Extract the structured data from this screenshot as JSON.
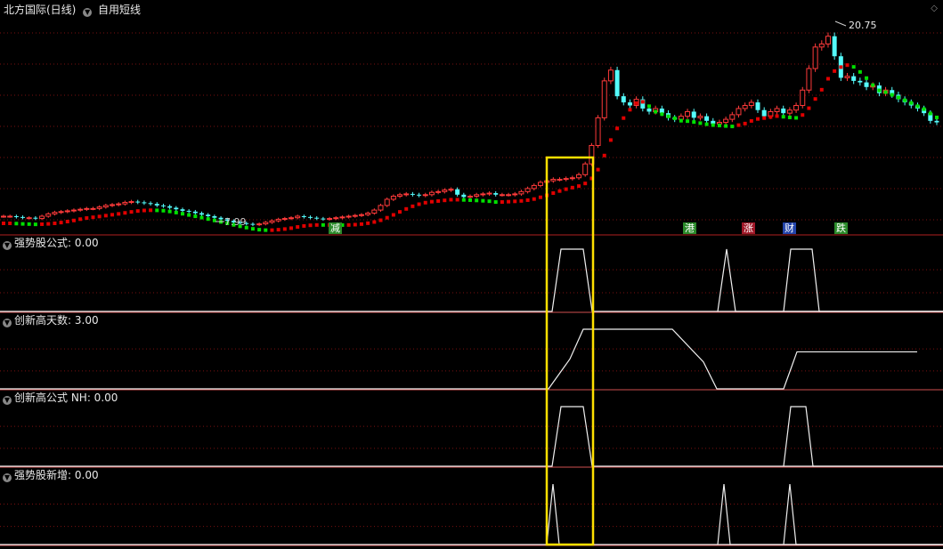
{
  "main": {
    "title": "北方国际(日线)",
    "formula": "自用短线",
    "high_label": "20.75",
    "low_label": "7.99"
  },
  "events": [
    {
      "label": "减",
      "color": "#2a8a2a"
    },
    {
      "label": "港",
      "color": "#2a8a2a"
    },
    {
      "label": "涨",
      "color": "#a01828"
    },
    {
      "label": "财",
      "color": "#2244aa"
    },
    {
      "label": "跌",
      "color": "#2a8a2a"
    }
  ],
  "panels": [
    {
      "label": "强势股公式",
      "value": ": 0.00"
    },
    {
      "label": "创新高天数",
      "value": ": 3.00"
    },
    {
      "label": "创新高公式  NH",
      "value": ": 0.00"
    },
    {
      "label": "强势股新增",
      "value": ": 0.00"
    }
  ],
  "colors": {
    "up": "#ff3a3a",
    "down": "#54fcfc",
    "trend_up": "#e00000",
    "trend_down": "#00e000",
    "grid": "#7a1010",
    "highlight": "#ffe000"
  },
  "chart_data": [
    {
      "type": "candlestick",
      "title": "北方国际(日线)",
      "ylim": [
        7.5,
        21.5
      ],
      "annotations": {
        "high": 20.75,
        "low": 7.99
      },
      "note": "approximate daily closes read from the chart",
      "closes": [
        8.6,
        8.6,
        8.55,
        8.5,
        8.5,
        8.45,
        8.6,
        8.75,
        8.85,
        8.9,
        8.95,
        9.0,
        9.05,
        9.1,
        9.1,
        9.2,
        9.3,
        9.35,
        9.4,
        9.5,
        9.55,
        9.5,
        9.45,
        9.4,
        9.3,
        9.25,
        9.15,
        9.05,
        8.95,
        8.9,
        8.8,
        8.7,
        8.6,
        8.5,
        8.4,
        8.3,
        8.2,
        8.15,
        8.1,
        8.05,
        8.1,
        8.2,
        8.3,
        8.4,
        8.45,
        8.5,
        8.6,
        8.55,
        8.5,
        8.45,
        8.4,
        8.45,
        8.5,
        8.55,
        8.6,
        8.65,
        8.7,
        8.8,
        9.0,
        9.3,
        9.7,
        9.9,
        10.0,
        10.05,
        10.0,
        9.95,
        10.0,
        10.15,
        10.2,
        10.3,
        10.35,
        10.0,
        9.85,
        9.9,
        10.0,
        10.05,
        10.1,
        10.0,
        10.0,
        10.0,
        10.05,
        10.2,
        10.4,
        10.6,
        10.8,
        10.9,
        11.0,
        11.0,
        11.05,
        11.1,
        11.3,
        12.0,
        13.2,
        15.0,
        17.4,
        18.1,
        16.4,
        16.0,
        15.8,
        16.2,
        15.6,
        15.4,
        15.6,
        15.3,
        15.0,
        14.9,
        15.1,
        15.4,
        15.0,
        15.1,
        14.8,
        14.6,
        14.7,
        14.9,
        15.2,
        15.6,
        15.8,
        16.0,
        15.5,
        15.1,
        15.4,
        15.6,
        15.3,
        15.5,
        15.8,
        16.8,
        18.2,
        19.6,
        19.8,
        20.3,
        19.0,
        17.6,
        17.7,
        17.4,
        17.3,
        17.0,
        17.1,
        16.6,
        16.8,
        16.5,
        16.2,
        16.0,
        15.8,
        15.6,
        15.3,
        14.8,
        14.7
      ]
    },
    {
      "type": "line",
      "name": "强势股公式",
      "ylim": [
        0,
        1
      ],
      "x": [
        0,
        616,
        630,
        640,
        650,
        670,
        680,
        1059
      ],
      "y": [
        0,
        0,
        1,
        1,
        1,
        1,
        0,
        0
      ],
      "segments": [
        {
          "x": [
            0,
            620,
            630,
            655,
            665,
            1059
          ],
          "y": [
            0,
            0,
            1,
            1,
            0,
            0
          ]
        },
        {
          "x": [
            806,
            816,
            826,
            1059
          ],
          "y": [
            0,
            1,
            0,
            0
          ]
        },
        {
          "x": [
            880,
            888,
            912,
            920,
            1059
          ],
          "y": [
            0,
            1,
            1,
            0,
            0
          ]
        }
      ]
    },
    {
      "type": "line",
      "name": "创新高天数",
      "ylim": [
        0,
        1
      ],
      "x": [
        0,
        616,
        640,
        655,
        755,
        790,
        805,
        880,
        895,
        1030
      ],
      "y": [
        0,
        0,
        0.5,
        1,
        1,
        0.45,
        0,
        0,
        0.62,
        0.62
      ]
    },
    {
      "type": "line",
      "name": "创新高公式  NH",
      "ylim": [
        0,
        1
      ],
      "segments": [
        {
          "x": [
            0,
            620,
            630,
            655,
            665,
            1059
          ],
          "y": [
            0,
            0,
            1,
            1,
            0,
            0
          ]
        },
        {
          "x": [
            880,
            888,
            905,
            913,
            1059
          ],
          "y": [
            0,
            1,
            1,
            0,
            0
          ]
        }
      ]
    },
    {
      "type": "line",
      "name": "强势股新增",
      "ylim": [
        0,
        1
      ],
      "segments": [
        {
          "x": [
            0,
            614,
            621,
            628,
            1059
          ],
          "y": [
            0,
            0,
            1,
            0,
            0
          ]
        },
        {
          "x": [
            806,
            813,
            820,
            1059
          ],
          "y": [
            0,
            1,
            0,
            0
          ]
        },
        {
          "x": [
            880,
            887,
            894,
            1059
          ],
          "y": [
            0,
            1,
            0,
            0
          ]
        }
      ]
    }
  ]
}
